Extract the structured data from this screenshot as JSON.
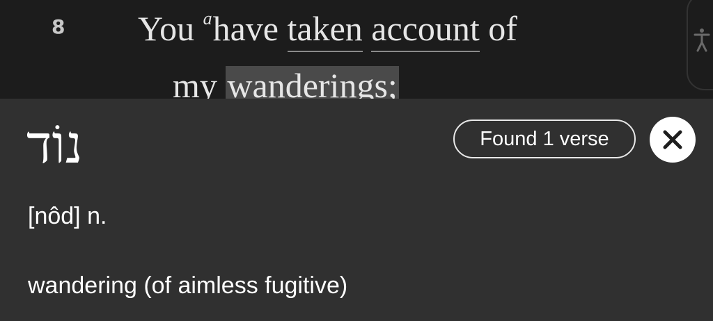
{
  "verse": {
    "number": "8",
    "line1": {
      "w1": "You",
      "footnote": "a",
      "w2": "have",
      "w3": "taken",
      "w4": "account",
      "w5": "of"
    },
    "line2": {
      "w1": "my",
      "w2": "wanderings;"
    }
  },
  "side_tab": {
    "icon": "accessibility-person-icon"
  },
  "lexicon": {
    "hebrew": "נוֹד",
    "found_label": "Found 1 verse",
    "close_icon": "close-icon",
    "pronunciation": "[nôd] n.",
    "definition": "wandering (of aimless fugitive)"
  },
  "colors": {
    "reader_bg": "#1c1c1c",
    "panel_bg": "#303030",
    "highlight": "#4a4a4a",
    "text": "#ffffff"
  }
}
